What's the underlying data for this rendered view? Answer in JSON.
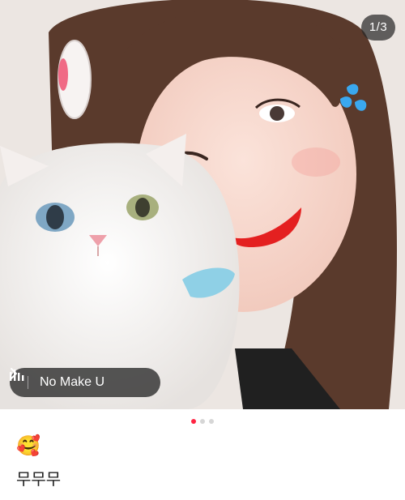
{
  "post": {
    "image_counter": "1/3",
    "current_image": 1,
    "total_images": 3
  },
  "music": {
    "title": "No Make U",
    "icon": "sound-bars-icon",
    "action_icon": "chevron-right-icon"
  },
  "pager": {
    "active_index": 0,
    "count": 3,
    "active_color": "#ff2442",
    "inactive_color": "#d6d6d6"
  },
  "caption": {
    "emoji": "🥰",
    "text": "무무무"
  }
}
